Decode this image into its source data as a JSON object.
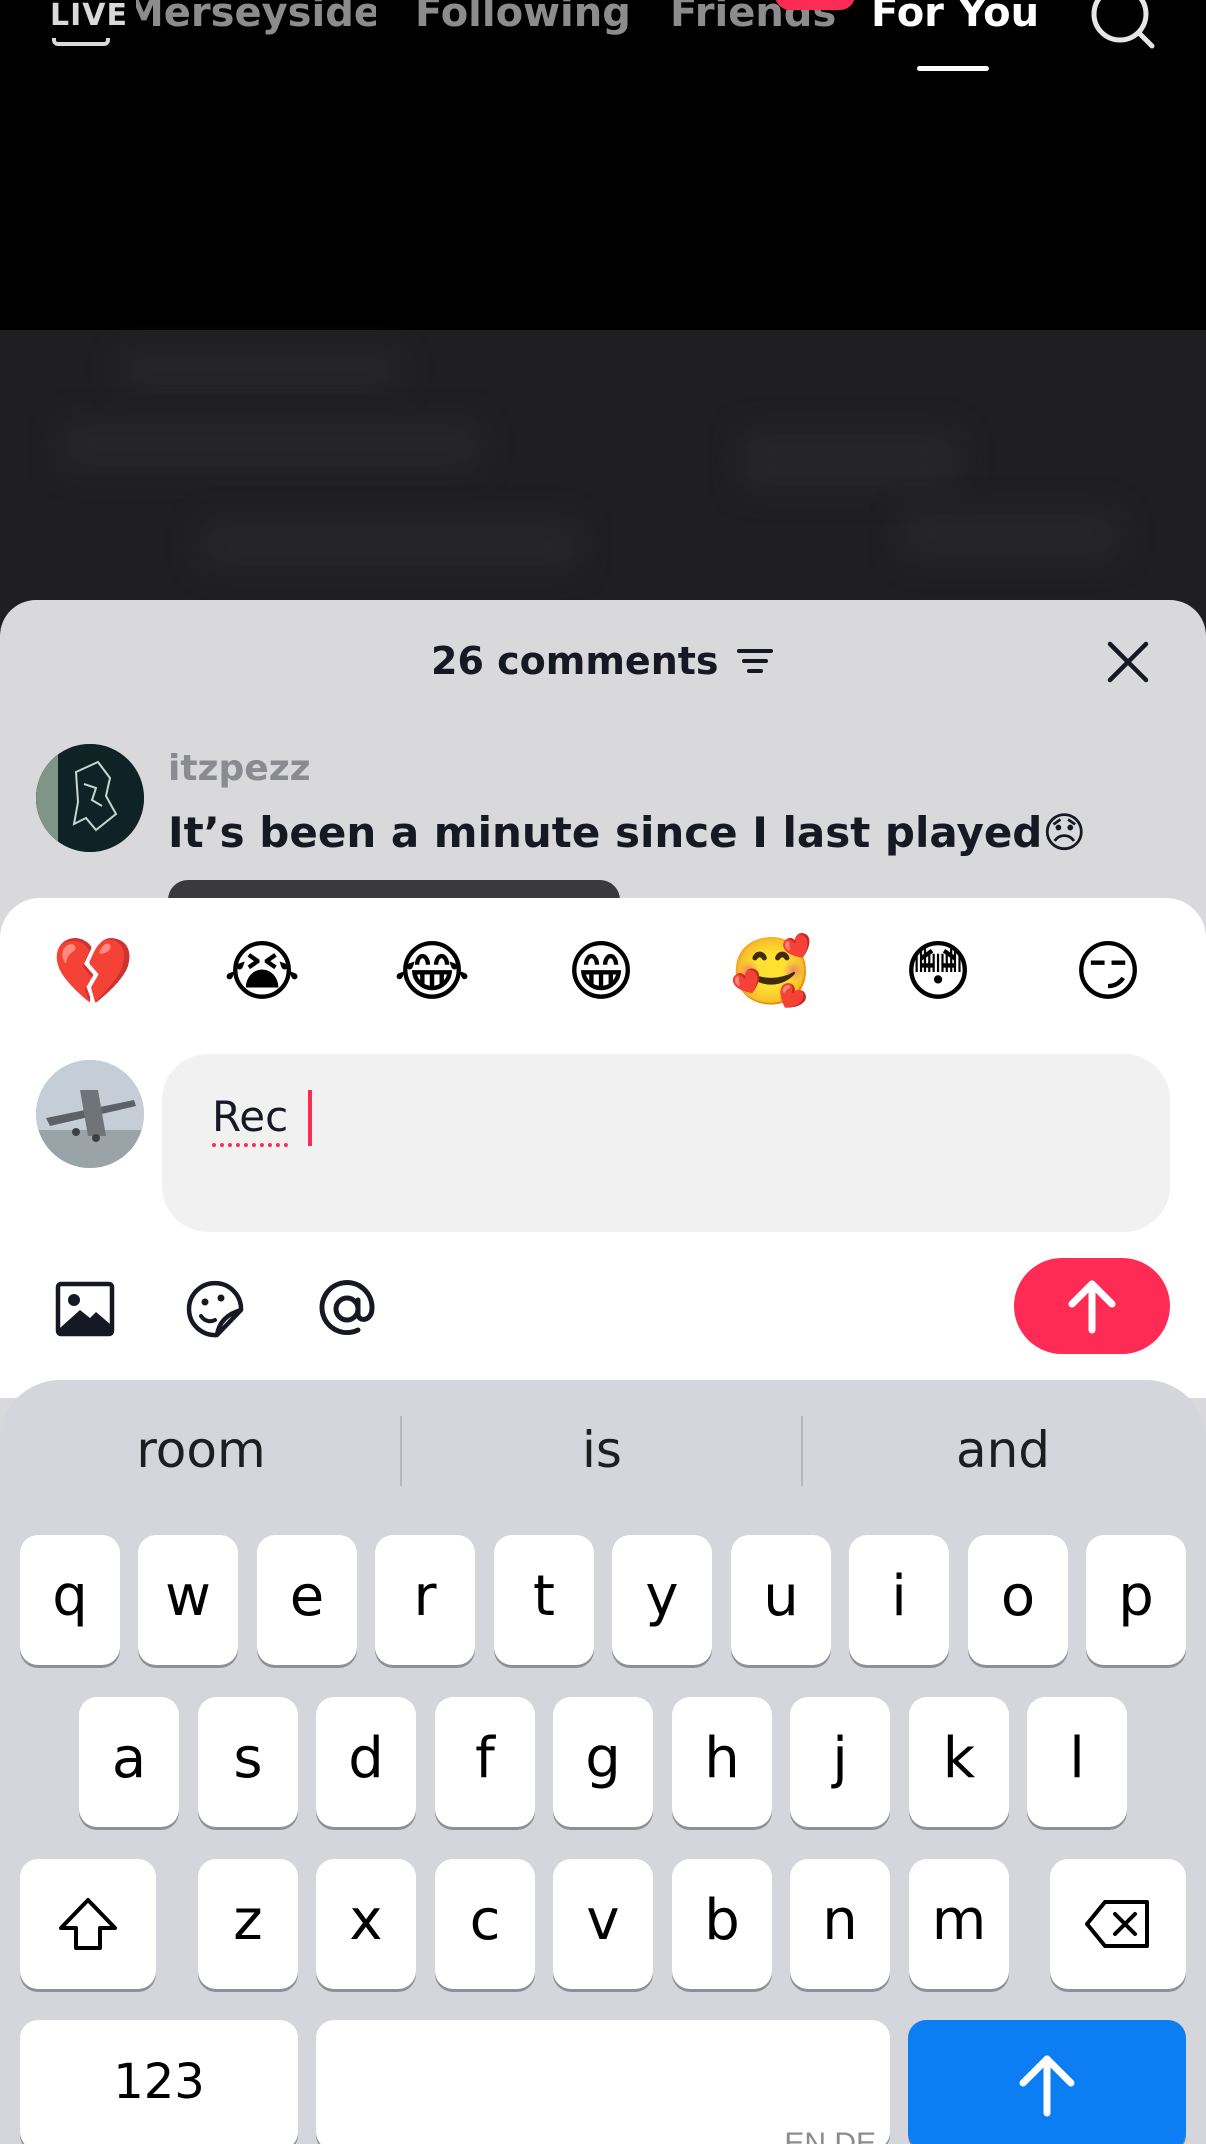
{
  "top_nav": {
    "live_label": "LIVE",
    "tabs": [
      "Merseyside",
      "Following",
      "Friends",
      "For You"
    ],
    "active_tab": "For You"
  },
  "comments": {
    "title": "26 comments",
    "items": [
      {
        "username": "itzpezz",
        "text": "It’s been a minute since I last played😞"
      }
    ]
  },
  "composer": {
    "quick_emojis": [
      "💔",
      "😭",
      "😂",
      "😁",
      "🥰",
      "😳",
      "😏"
    ],
    "input_value": "Rec"
  },
  "keyboard": {
    "predictions": [
      "room",
      "is",
      "and"
    ],
    "rows": [
      [
        "q",
        "w",
        "e",
        "r",
        "t",
        "y",
        "u",
        "i",
        "o",
        "p"
      ],
      [
        "a",
        "s",
        "d",
        "f",
        "g",
        "h",
        "j",
        "k",
        "l"
      ],
      [
        "z",
        "x",
        "c",
        "v",
        "b",
        "n",
        "m"
      ]
    ],
    "numbers_label": "123",
    "space_label": "EN DE"
  },
  "colors": {
    "accent": "#fe2c55",
    "return_key": "#0b7ef4",
    "panel": "#d9d9db",
    "keyboard_bg": "#d4d6dc"
  }
}
